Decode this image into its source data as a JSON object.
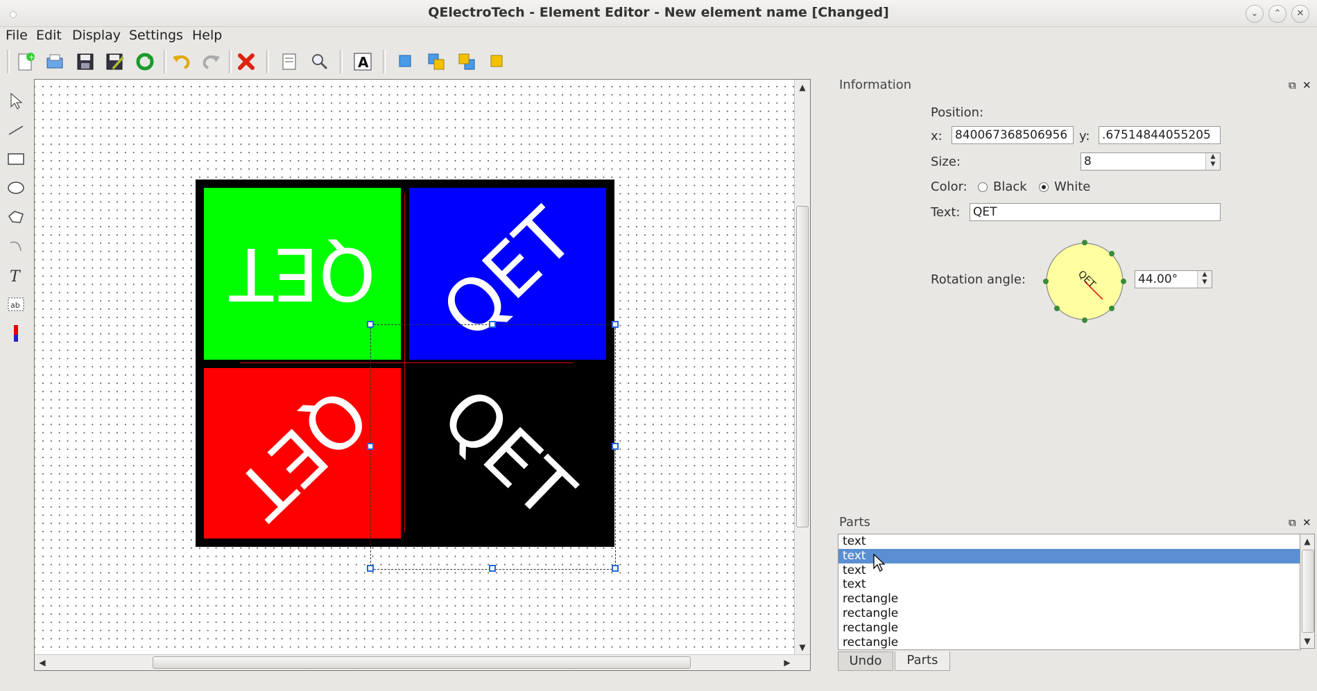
{
  "window": {
    "title": "QElectroTech - Element Editor - New element name [Changed]"
  },
  "window_controls": {
    "minimize": "⌄",
    "maximize": "⌃",
    "close": "✕"
  },
  "menu": [
    {
      "label": "File"
    },
    {
      "label": "Edit"
    },
    {
      "label": "Display"
    },
    {
      "label": "Settings"
    },
    {
      "label": "Help"
    }
  ],
  "toolbar_icons": [
    "new-element-icon",
    "open-icon",
    "save-icon",
    "save-as-icon",
    "reload-icon",
    "undo-icon",
    "redo-icon",
    "delete-icon",
    "properties-icon",
    "zoom-icon",
    "text-field-icon",
    "bring-forward-icon",
    "raise-icon",
    "lower-icon",
    "send-backward-icon"
  ],
  "tools": [
    "pointer-icon",
    "line-icon",
    "rectangle-icon",
    "ellipse-icon",
    "polygon-icon",
    "arc-icon",
    "text-icon",
    "text-field-icon",
    "terminal-icon"
  ],
  "element": {
    "quadrants": [
      {
        "name": "green",
        "color": "#00ff00",
        "text": "QET",
        "angle": 180
      },
      {
        "name": "blue",
        "color": "#0000ff",
        "text": "QET",
        "angle": -44
      },
      {
        "name": "red",
        "color": "#ff0000",
        "text": "QET",
        "angle": 136
      },
      {
        "name": "black",
        "color": "#000000",
        "text": "QET",
        "angle": 44
      }
    ]
  },
  "info": {
    "dock_title": "Information",
    "position_label": "Position:",
    "x_label": "x:",
    "x_value": "840067368506956",
    "y_label": "y:",
    "y_value": ".67514844055205",
    "size_label": "Size:",
    "size_value": "8",
    "color_label": "Color:",
    "color_black": "Black",
    "color_white": "White",
    "color_selected": "White",
    "text_label": "Text:",
    "text_value": "QET",
    "rotation_label": "Rotation angle:",
    "rotation_value": "44.00°",
    "dial_text": "QET"
  },
  "parts": {
    "dock_title": "Parts",
    "items": [
      "text",
      "text",
      "text",
      "text",
      "rectangle",
      "rectangle",
      "rectangle",
      "rectangle"
    ],
    "selected_index": 1
  },
  "tabs": [
    {
      "label": "Undo"
    },
    {
      "label": "Parts",
      "active": true
    }
  ],
  "colors": {
    "selection": "#5a8fd3",
    "handle": "#2266dd",
    "dial": "#ffffa0"
  }
}
